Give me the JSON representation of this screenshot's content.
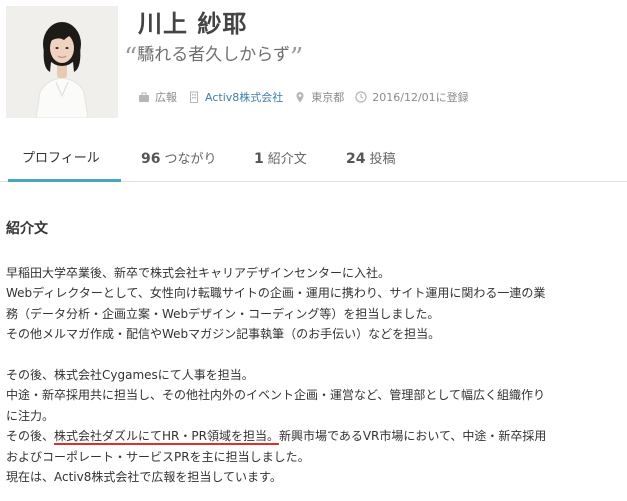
{
  "profile": {
    "name": "川上 紗耶",
    "tagline": "驕れる者久しからず",
    "tagline_open_quote": "“",
    "tagline_close_quote": "”",
    "meta": {
      "job": "広報",
      "company": "Activ8株式会社",
      "location": "東京都",
      "registered": "2016/12/01に登録"
    }
  },
  "tabs": [
    {
      "label": "プロフィール",
      "count": ""
    },
    {
      "label": "つながり",
      "count": "96"
    },
    {
      "label": "紹介文",
      "count": "1"
    },
    {
      "label": "投稿",
      "count": "24"
    }
  ],
  "section": {
    "title": "紹介文",
    "lines": [
      "早稲田大学卒業後、新卒で株式会社キャリアデザインセンターに入社。",
      "Webディレクターとして、女性向け転職サイトの企画・運用に携わり、サイト運用に関わる一連の業",
      "務（データ分析・企画立案・Webデザイン・コーディング等）を担当しました。",
      "その他メルマガ作成・配信やWebマガジン記事執筆（のお手伝い）などを担当。",
      "その後、株式会社Cygamesにて人事を担当。",
      "中途・新卒採用共に担当し、その他社内外のイベント企画・運営など、管理部として幅広く組織作り",
      "に注力。",
      "その後、",
      "株式会社ダズルにてHR・PR領域を担当。",
      "新興市場であるVR市場において、中途・新卒採用",
      "およびコーポレート・サービスPRを主に担当しました。",
      "現在は、Activ8株式会社で広報を担当しています。"
    ]
  },
  "colors": {
    "accent": "#4aa3bf",
    "link": "#3f7fa8",
    "highlight_underline": "#d9322b"
  }
}
